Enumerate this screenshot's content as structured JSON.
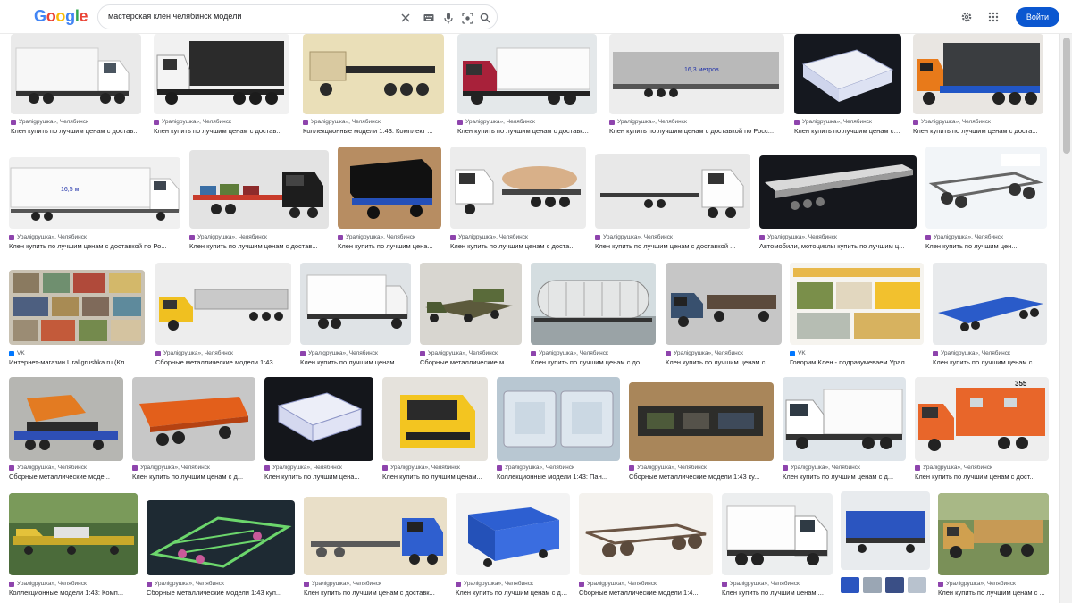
{
  "header": {
    "logo": [
      "G",
      "o",
      "o",
      "g",
      "l",
      "e"
    ],
    "logo_colors": [
      "#4285f4",
      "#ea4335",
      "#fbbc05",
      "#4285f4",
      "#34a853",
      "#ea4335"
    ],
    "query": "мастерская клен челябинск модели",
    "signin_label": "Войти",
    "icons": [
      "close-icon",
      "keyboard-icon",
      "microphone-icon",
      "lens-icon",
      "search-icon",
      "gear-icon",
      "apps-icon"
    ]
  },
  "sources": {
    "ural": "Уралigрушка», Челябинск",
    "vk": "VK"
  },
  "results": [
    {
      "source": "Уралigрушка», Челябинск",
      "title": "Клен купить по лучшим ценам с достав..."
    },
    {
      "source": "Уралigрушка», Челябинск",
      "title": "Клен купить по лучшим ценам с достав..."
    },
    {
      "source": "Уралigрушка», Челябинск",
      "title": "Коллекционные модели 1:43: Комплект ..."
    },
    {
      "source": "Уралigрушка», Челябинск",
      "title": "Клен купить по лучшим ценам с доставк..."
    },
    {
      "source": "Уралigрушка», Челябинск",
      "title": "Клен купить по лучшим ценам с доставкой по Росс..."
    },
    {
      "source": "Уралigрушка», Челябинск",
      "title": "Клен купить по лучшим ценам с до..."
    },
    {
      "source": "Уралigрушка», Челябинск",
      "title": "Клен купить по лучшим ценам с доста..."
    },
    {
      "source": "Уралigрушка», Челябинск",
      "title": "Клен купить по лучшим ценам с доставкой по Ро..."
    },
    {
      "source": "Уралigрушка», Челябинск",
      "title": "Клен купить по лучшим ценам с достав..."
    },
    {
      "source": "Уралigрушка», Челябинск",
      "title": "Клен купить по лучшим цена..."
    },
    {
      "source": "Уралigрушка», Челябинск",
      "title": "Клен купить по лучшим ценам с доста..."
    },
    {
      "source": "Уралigрушка», Челябинск",
      "title": "Клен купить по лучшим ценам с доставкой ..."
    },
    {
      "source": "Уралigрушка», Челябинск",
      "title": "Автомобили, мотоциклы купить по лучшим ц..."
    },
    {
      "source": "Уралigрушка», Челябинск",
      "title": "Клен купить по лучшим цен..."
    },
    {
      "source": "VK",
      "title": "Интернет-магазин Uraligrushka.ru (Кл..."
    },
    {
      "source": "Уралigрушка», Челябинск",
      "title": "Сборные металлические модели 1:43..."
    },
    {
      "source": "Уралigрушка», Челябинск",
      "title": "Клен купить по лучшим ценам..."
    },
    {
      "source": "Уралigрушка», Челябинск",
      "title": "Сборные металлические м..."
    },
    {
      "source": "Уралigрушка», Челябинск",
      "title": "Клен купить по лучшим ценам с до..."
    },
    {
      "source": "Уралigрушка», Челябинск",
      "title": "Клен купить по лучшим ценам с..."
    },
    {
      "source": "VK",
      "title": "Говорим Клен - подразумеваем Урал..."
    },
    {
      "source": "Уралigрушка», Челябинск",
      "title": "Клен купить по лучшим ценам с..."
    },
    {
      "source": "Уралigрушка», Челябинск",
      "title": "Сборные металлические моде..."
    },
    {
      "source": "Уралigрушка», Челябинск",
      "title": "Клен купить по лучшим ценам с д..."
    },
    {
      "source": "Уралigрушка», Челябинск",
      "title": "Клен купить по лучшим цена..."
    },
    {
      "source": "Уралigрушка», Челябинск",
      "title": "Клен купить по лучшим ценам..."
    },
    {
      "source": "Уралigрушка», Челябинск",
      "title": "Коллекционные модели 1:43: Пан..."
    },
    {
      "source": "Уралigрушка», Челябинск",
      "title": "Сборные металлические модели 1:43 ку..."
    },
    {
      "source": "Уралigрушка», Челябинск",
      "title": "Клен купить по лучшим ценам с д..."
    },
    {
      "source": "Уралigрушка», Челябинск",
      "title": "Клен купить по лучшим ценам с дост..."
    },
    {
      "source": "Уралigрушка», Челябинск",
      "title": "Коллекционные модели 1:43: Комп..."
    },
    {
      "source": "Уралigрушка», Челябинск",
      "title": "Сборные металлические модели 1:43 куп..."
    },
    {
      "source": "Уралigрушка», Челябинск",
      "title": "Клен купить по лучшим ценам с доставк..."
    },
    {
      "source": "Уралigрушка», Челябинск",
      "title": "Клен купить по лучшим ценам с дос..."
    },
    {
      "source": "Уралigрушка», Челябинск",
      "title": "Сборные металлические модели 1:4..."
    },
    {
      "source": "Уралigрушка», Челябинск",
      "title": "Клен купить по лучшим ценам ..."
    },
    {
      "source": "",
      "title": ""
    },
    {
      "source": "Уралigрушка», Челябинск",
      "title": "Клен купить по лучшим ценам с ..."
    }
  ],
  "image_captions": {
    "length_16_3": "16,3 метров",
    "length_16_5": "16,5 м",
    "number_355": "355"
  },
  "colors": {
    "accent": "#0b57d0",
    "fav_ural": "#8e44ad",
    "fav_vk": "#0077ff"
  }
}
